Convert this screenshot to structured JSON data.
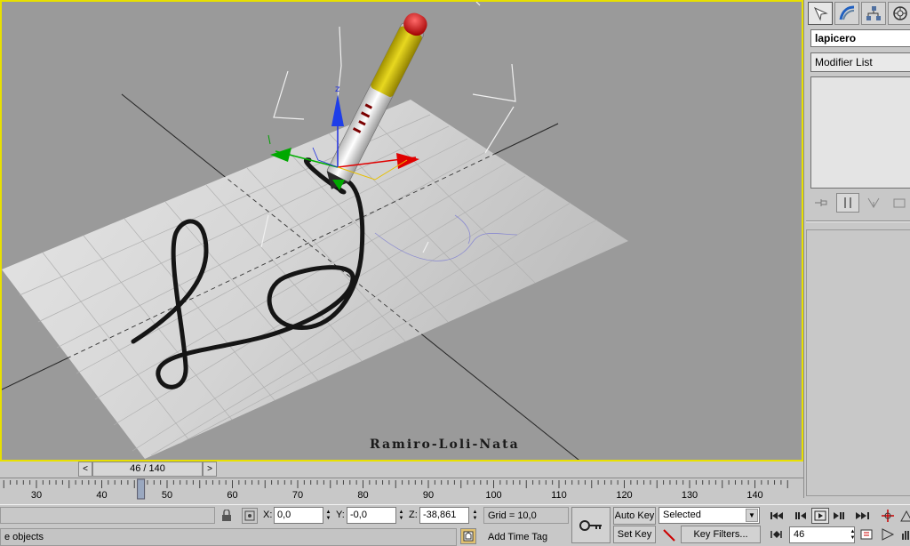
{
  "viewport": {
    "caption": "Ramiro-Loli-Nata",
    "gizmo_axis_label": "z"
  },
  "command_panel": {
    "tabs": [
      "create-icon",
      "modify-icon",
      "hierarchy-icon",
      "motion-icon"
    ],
    "object_name": "lapicero",
    "modifier_list_label": "Modifier List"
  },
  "time_slider": {
    "label": "46 / 140",
    "prev": "<",
    "next": ">",
    "current_frame": 46,
    "total_frames": 140
  },
  "track_ruler": {
    "labels": [
      "30",
      "40",
      "50",
      "60",
      "70",
      "80",
      "90",
      "100",
      "110",
      "120",
      "130",
      "140"
    ]
  },
  "status": {
    "prompt_text": "e objects",
    "x_label": "X:",
    "x_value": "0,0",
    "y_label": "Y:",
    "y_value": "-0,0",
    "z_label": "Z:",
    "z_value": "-38,861",
    "grid_text": "Grid = 10,0",
    "add_time_tag_label": "Add Time Tag"
  },
  "animation": {
    "auto_key_label": "Auto Key",
    "set_key_label": "Set Key",
    "key_mode_selected": "Selected",
    "key_filters_label": "Key Filters...",
    "frame_value": "46"
  },
  "colors": {
    "viewport_border": "#e8e000",
    "viewport_bg": "#9a9a9a",
    "ui_bg": "#c8c8c8"
  }
}
